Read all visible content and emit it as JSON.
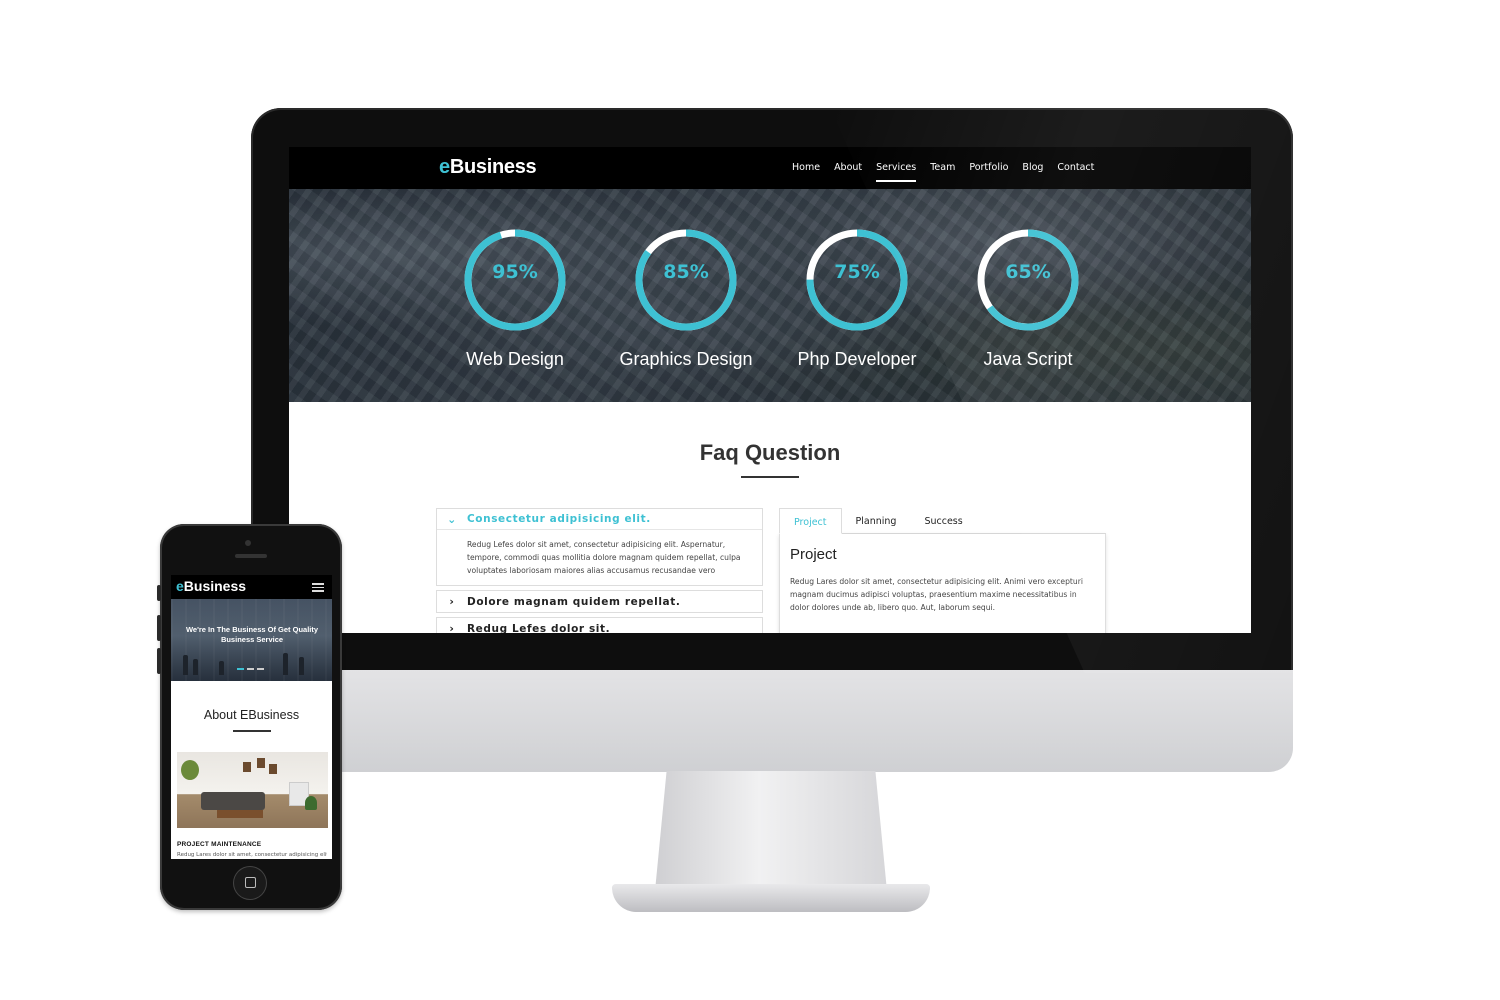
{
  "desktop": {
    "logo": {
      "prefix": "e",
      "rest": "Business"
    },
    "nav": {
      "items": [
        {
          "label": "Home"
        },
        {
          "label": "About"
        },
        {
          "label": "Services",
          "active": true
        },
        {
          "label": "Team"
        },
        {
          "label": "Portfolio"
        },
        {
          "label": "Blog"
        },
        {
          "label": "Contact"
        }
      ]
    },
    "skills": [
      {
        "percent_label": "95%",
        "value": 0.95,
        "label": "Web Design"
      },
      {
        "percent_label": "85%",
        "value": 0.85,
        "label": "Graphics Design"
      },
      {
        "percent_label": "75%",
        "value": 0.75,
        "label": "Php Developer"
      },
      {
        "percent_label": "65%",
        "value": 0.65,
        "label": "Java Script"
      }
    ],
    "accent_color": "#3ec1d3",
    "faq": {
      "title": "Faq Question",
      "items": [
        {
          "question": "Consectetur adipisicing elit.",
          "open": true,
          "answer": "Redug Lefes dolor sit amet, consectetur adipisicing elit. Aspernatur, tempore, commodi quas mollitia dolore magnam quidem repellat, culpa voluptates laboriosam maiores alias accusamus recusandae vero"
        },
        {
          "question": "Dolore magnam quidem repellat.",
          "open": false
        },
        {
          "question": "Redug Lefes dolor sit.",
          "open": false
        }
      ]
    },
    "tabs": {
      "items": [
        {
          "label": "Project",
          "active": true
        },
        {
          "label": "Planning"
        },
        {
          "label": "Success"
        }
      ],
      "panel_title": "Project",
      "panel_text": "Redug Lares dolor sit amet, consectetur adipisicing elit. Animi vero excepturi magnam ducimus adipisci voluptas, praesentium maxime necessitatibus in dolor dolores unde ab, libero quo. Aut, laborum sequi."
    }
  },
  "mobile": {
    "logo": {
      "prefix": "e",
      "rest": "Business"
    },
    "hero_text": "We're In The Business Of Get Quality Business Service",
    "about_title": "About EBusiness",
    "project_heading": "PROJECT MAINTENANCE",
    "project_text": "Redug Lares dolor sit amet, consectetur adipisicing elit."
  }
}
